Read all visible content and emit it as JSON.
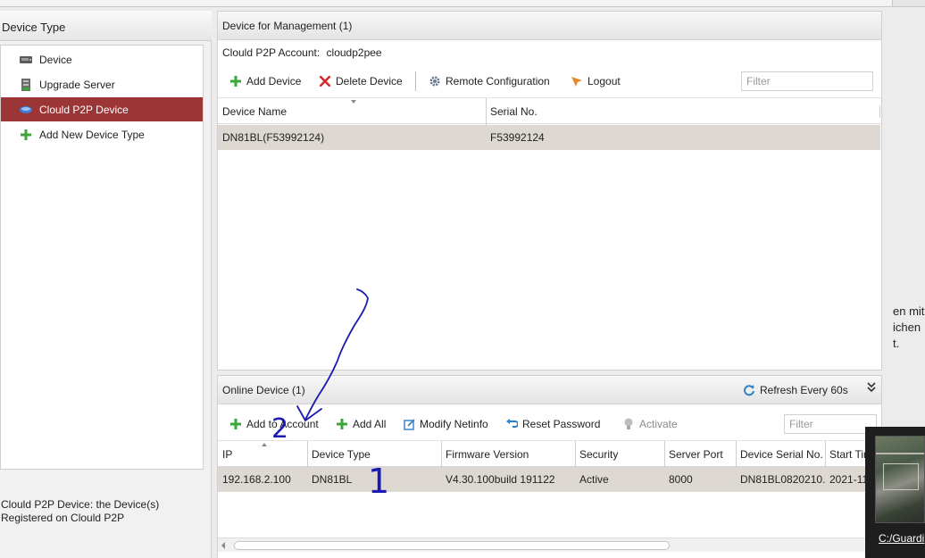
{
  "left_panel": {
    "title": "Device Type",
    "items": [
      {
        "label": "Device",
        "icon": "device-icon",
        "selected": false
      },
      {
        "label": "Upgrade Server",
        "icon": "upgrade-server-icon",
        "selected": false
      },
      {
        "label": "Clould P2P Device",
        "icon": "cloud-device-icon",
        "selected": true
      },
      {
        "label": "Add New Device Type",
        "icon": "plus-icon",
        "selected": false
      }
    ],
    "description": {
      "line1": "Clould P2P Device: the Device(s)",
      "line2": "Registered on Clould P2P"
    }
  },
  "management": {
    "title": "Device for Management (1)",
    "account_label": "Clould P2P Account:",
    "account_value": "cloudp2pee",
    "toolbar": {
      "add": "Add Device",
      "delete": "Delete Device",
      "remote": "Remote Configuration",
      "logout": "Logout",
      "filter_placeholder": "Filter"
    },
    "columns": [
      "Device Name",
      "Serial No."
    ],
    "rows": [
      {
        "device_name": "DN81BL(F53992124)",
        "serial": "F53992124"
      }
    ]
  },
  "online": {
    "title": "Online Device (1)",
    "refresh": "Refresh Every 60s",
    "toolbar": {
      "add_to_account": "Add to Account",
      "add_all": "Add All",
      "modify_netinfo": "Modify Netinfo",
      "reset_password": "Reset Password",
      "activate": "Activate",
      "filter_placeholder": "Filter"
    },
    "columns": [
      "IP",
      "Device Type",
      "Firmware Version",
      "Security",
      "Server Port",
      "Device Serial No.",
      "Start Tim"
    ],
    "rows": [
      {
        "ip": "192.168.2.100",
        "device_type": "DN81BL",
        "firmware": "V4.30.100build 191122",
        "security": "Active",
        "server_port": "8000",
        "serial": "DN81BL0820210...",
        "start_time": "2021-11"
      }
    ]
  },
  "background_text": [
    "en mit",
    "ichen",
    "t."
  ],
  "thumbnail": {
    "caption": "C:/Guardi"
  },
  "annotations": {
    "label_1": "1",
    "label_2": "2"
  },
  "colors": {
    "selected_row_bg": "#9c3535",
    "data_row_bg": "#ddd8d2",
    "plus_green": "#3aa63a",
    "delete_red": "#d42a2a",
    "refresh_blue": "#2f7fc9",
    "annotation_blue": "#1a1ab0"
  }
}
